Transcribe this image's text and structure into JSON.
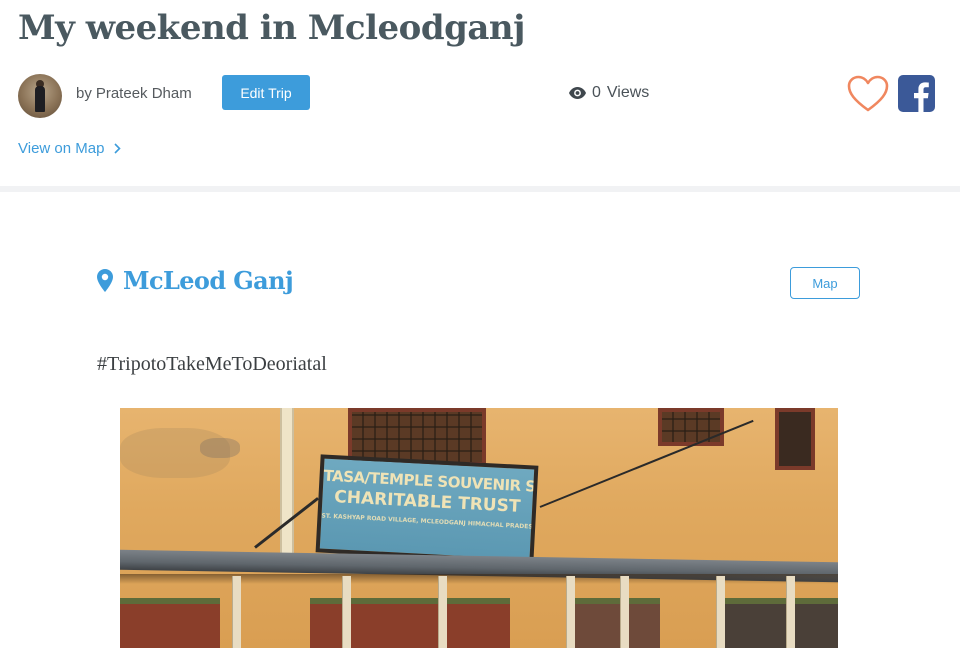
{
  "trip": {
    "title": "My weekend in Mcleodganj",
    "author_prefix": "by",
    "author_name": "Prateek Dham",
    "edit_label": "Edit Trip",
    "views_count": "0",
    "views_label": "Views",
    "view_on_map_label": "View on Map"
  },
  "section": {
    "place_name": "McLeod Ganj",
    "map_button_label": "Map",
    "hashtag": "#TripotoTakeMeToDeoriatal"
  },
  "photo": {
    "sign_line1": "TASA/TEMPLE SOUVENIR SHOP",
    "sign_line2": "CHARITABLE TRUST",
    "sign_line3": "ST. KASHYAP ROAD VILLAGE, MCLEODGANJ HIMACHAL PRADESH — DEALERS OF RELIGIOUS ITEMS & SOUVENIRS"
  },
  "icons": {
    "eye": "eye-icon",
    "heart": "heart-icon",
    "facebook": "facebook-icon",
    "chevron": "chevron-right-icon",
    "location": "location-pin-icon"
  },
  "colors": {
    "accent": "#3d9cdb",
    "title": "#4a5960",
    "heart": "#f0875f",
    "facebook": "#3b5998"
  }
}
